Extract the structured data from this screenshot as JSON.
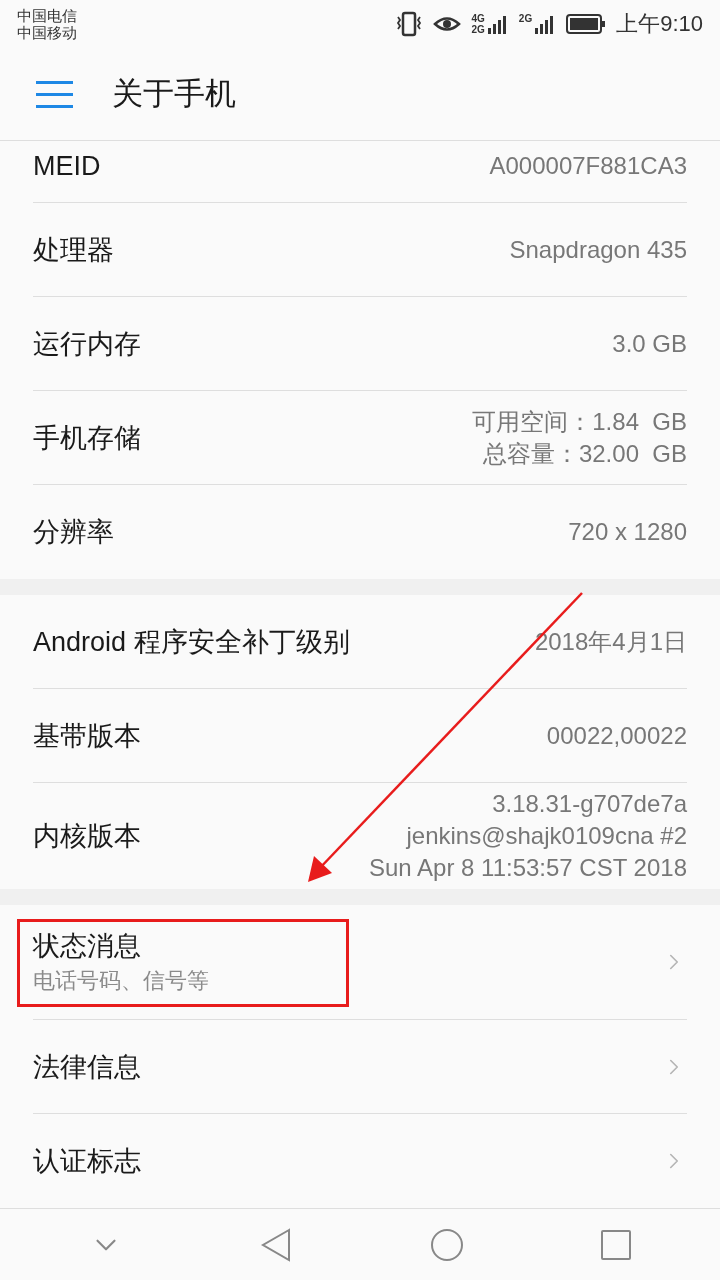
{
  "status_bar": {
    "carriers": [
      "中国电信",
      "中国移动"
    ],
    "network_labels": [
      "4G",
      "2G",
      "2G"
    ],
    "time": "上午9:10"
  },
  "header": {
    "title": "关于手机"
  },
  "sections": [
    {
      "items": [
        {
          "kind": "info",
          "label": "MEID",
          "values": [
            "A000007F881CA3"
          ]
        },
        {
          "kind": "info",
          "label": "处理器",
          "values": [
            "Snapdragon 435"
          ]
        },
        {
          "kind": "info",
          "label": "运行内存",
          "values": [
            "3.0 GB"
          ]
        },
        {
          "kind": "info",
          "label": "手机存储",
          "values": [
            "可用空间：1.84  GB",
            "总容量：32.00  GB"
          ]
        },
        {
          "kind": "info",
          "label": "分辨率",
          "values": [
            "720 x 1280"
          ]
        }
      ]
    },
    {
      "items": [
        {
          "kind": "info",
          "label": "Android 程序安全补丁级别",
          "values": [
            "2018年4月1日"
          ]
        },
        {
          "kind": "info",
          "label": "基带版本",
          "values": [
            "00022,00022"
          ]
        },
        {
          "kind": "info",
          "label": "内核版本",
          "values": [
            "3.18.31-g707de7a",
            "jenkins@shajk0109cna #2",
            "Sun Apr 8 11:53:57 CST 2018"
          ]
        }
      ]
    },
    {
      "items": [
        {
          "kind": "link",
          "label": "状态消息",
          "subtitle": "电话号码、信号等",
          "highlighted": true
        },
        {
          "kind": "link",
          "label": "法律信息",
          "highlighted": false
        },
        {
          "kind": "link",
          "label": "认证标志",
          "highlighted": false
        }
      ]
    }
  ]
}
